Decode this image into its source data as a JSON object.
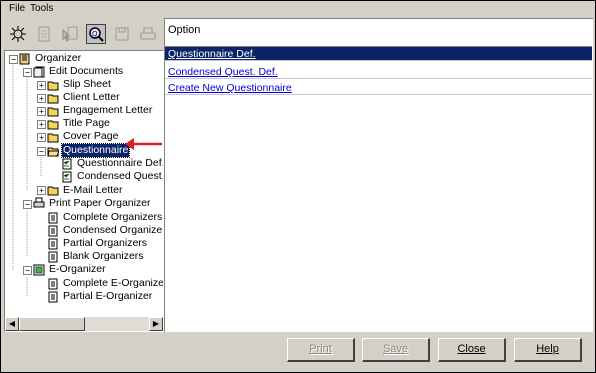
{
  "menubar": {
    "file": "File",
    "tools": "Tools"
  },
  "tree": {
    "organizer": "Organizer",
    "edit_documents": "Edit Documents",
    "slip_sheet": "Slip Sheet",
    "client_letter": "Client Letter",
    "engagement_letter": "Engagement Letter",
    "title_page": "Title Page",
    "cover_page": "Cover Page",
    "questionnaire": "Questionnaire",
    "questionnaire_def": "Questionnaire Def.",
    "condensed_quest": "Condensed Quest.",
    "email_letter": "E-Mail Letter",
    "print_paper": "Print Paper Organizer",
    "complete_organizers": "Complete Organizers",
    "condensed_organizers": "Condensed Organizers",
    "partial_organizers": "Partial Organizers",
    "blank_organizers": "Blank Organizers",
    "e_organizer": "E-Organizer",
    "complete_e_organizer": "Complete E-Organizer",
    "partial_e_organizer": "Partial E-Organizer"
  },
  "list": {
    "header": "Option",
    "rows": [
      "Questionnaire Def.",
      "Condensed Quest. Def.",
      "Create New Questionnaire"
    ]
  },
  "buttons": {
    "print": "Print",
    "save": "Save",
    "close": "Close",
    "help": "Help"
  },
  "colors": {
    "selection": "#0a246a",
    "link": "#0000cc",
    "annotation_arrow": "#e02020"
  }
}
